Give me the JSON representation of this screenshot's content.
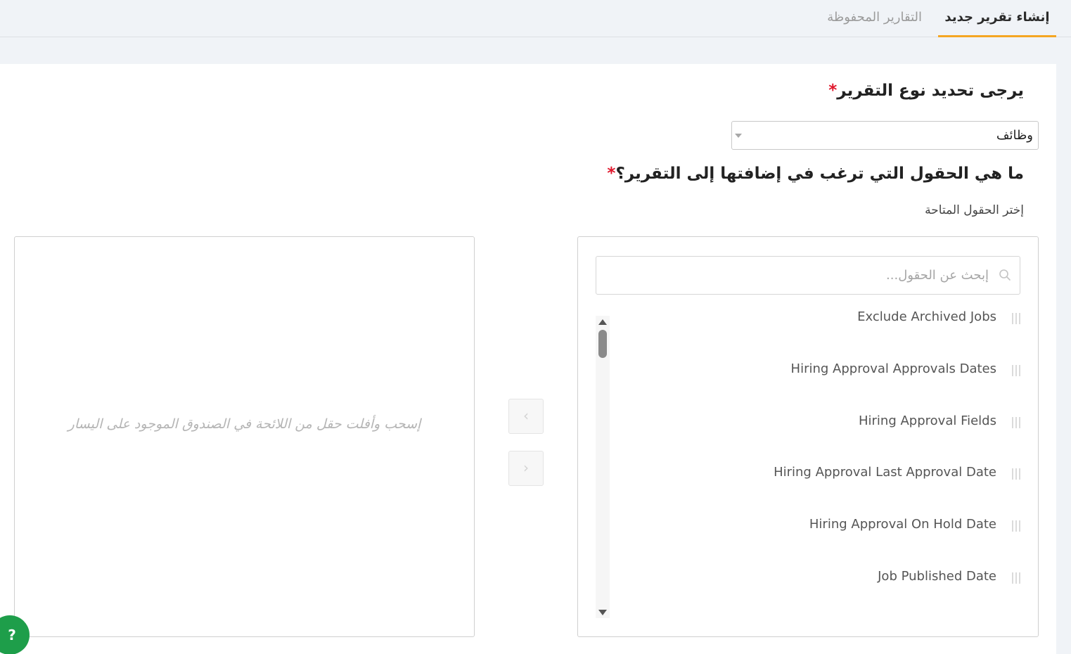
{
  "tabs": {
    "create_new": "إنشاء تقرير جديد",
    "saved_reports": "التقارير المحفوظة"
  },
  "form": {
    "report_type_heading": "يرجى تحديد نوع التقرير",
    "required_mark": "*",
    "report_type_value": "وظائف",
    "fields_heading": "ما هي الحقول التي ترغب في إضافتها إلى التقرير؟",
    "available_fields_label": "إختر الحقول المتاحة"
  },
  "selected_box": {
    "placeholder": "إسحب وأفلت حقل من اللائحة في الصندوق الموجود على اليسار"
  },
  "available_box": {
    "search_placeholder": "إبحث عن الحقول...",
    "fields": [
      "Exclude Archived Jobs",
      "Hiring Approval Approvals Dates",
      "Hiring Approval Fields",
      "Hiring Approval Last Approval Date",
      "Hiring Approval On Hold Date",
      "Job Published Date"
    ]
  },
  "transfer": {
    "move_left_icon": "‹",
    "move_right_icon": "›"
  },
  "help": {
    "label": "?"
  },
  "colors": {
    "accent": "#f5a623",
    "required": "#e0162b",
    "help_button": "#1e9e4a"
  }
}
